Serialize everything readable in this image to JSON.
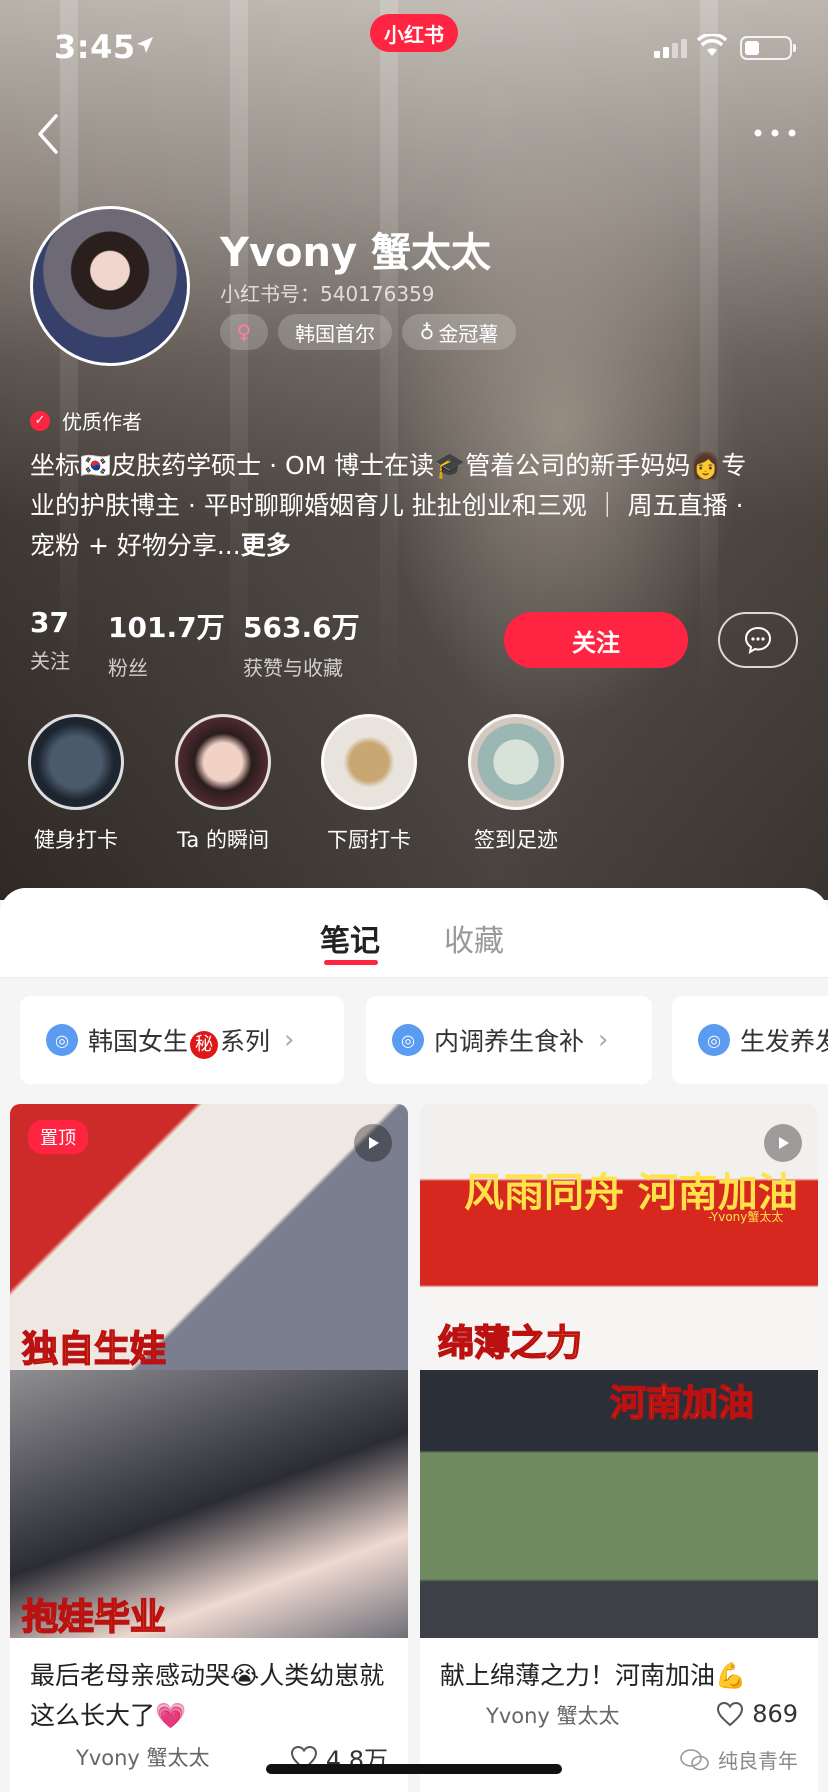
{
  "status_bar": {
    "time": "3:45",
    "brand": "小红书"
  },
  "profile": {
    "username": "Yvony 蟹太太",
    "id_text": "小红书号：540176359",
    "tags": {
      "gender": "♀",
      "location": "韩国首尔",
      "level": "金冠薯"
    },
    "badge": "优质作者",
    "bio_line1": "坐标🇰🇷皮肤药学硕士 · OM 博士在读🎓管着公司的新手妈妈👩专",
    "bio_line2": "业的护肤博主 · 平时聊聊婚姻育儿 扯扯创业和三观 ｜ 周五直播 ·",
    "bio_line3": "宠粉 + 好物分享...",
    "bio_more": "更多"
  },
  "stats": [
    {
      "value": "37",
      "label": "关注"
    },
    {
      "value": "101.7万",
      "label": "粉丝"
    },
    {
      "value": "563.6万",
      "label": "获赞与收藏"
    }
  ],
  "actions": {
    "follow": "关注"
  },
  "highlights": [
    {
      "label": "健身打卡"
    },
    {
      "label": "Ta 的瞬间"
    },
    {
      "label": "下厨打卡"
    },
    {
      "label": "签到足迹"
    }
  ],
  "tabs": {
    "notes": "笔记",
    "collect": "收藏"
  },
  "collections": [
    {
      "before": "韩国女生",
      "secret": "秘",
      "after": "系列"
    },
    {
      "label": "内调养生食补"
    },
    {
      "label": "生发养发"
    }
  ],
  "cards": [
    {
      "pinned": "置顶",
      "cover_top": "独自生娃",
      "cover_bottom": "抱娃毕业",
      "title": "最后老母亲感动哭😭人类幼崽就这么长大了💗",
      "author": "Yvony 蟹太太",
      "likes": "4.8万"
    },
    {
      "banner": "风雨同舟 河南加油",
      "banner_sub": "-Yvony蟹太太",
      "cover_mid1": "绵薄之力",
      "cover_mid2": "河南加油",
      "title": "献上绵薄之力！河南加油💪",
      "author": "Yvony 蟹太太",
      "likes": "869"
    }
  ],
  "watermark": "纯良青年",
  "colors": {
    "accent": "#ff2442",
    "collection_icon": "#5b9cf2"
  }
}
